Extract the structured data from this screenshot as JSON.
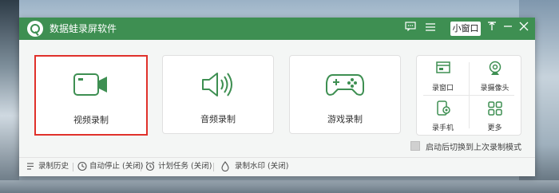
{
  "app": {
    "title": "数据蛙录屏软件",
    "accent": "#3e8f52",
    "mini_window_label": "小窗口"
  },
  "titlebar_icons": [
    "message-icon",
    "menu-icon",
    "pin-icon",
    "minimize-icon",
    "close-icon"
  ],
  "cards": [
    {
      "label": "视频录制",
      "icon": "camera-icon",
      "selected": true
    },
    {
      "label": "音频录制",
      "icon": "speaker-icon",
      "selected": false
    },
    {
      "label": "游戏录制",
      "icon": "gamepad-icon",
      "selected": false
    }
  ],
  "mini_panel": [
    {
      "label": "录窗口",
      "icon": "window-icon"
    },
    {
      "label": "录摄像头",
      "icon": "webcam-icon"
    },
    {
      "label": "录手机",
      "icon": "phone-icon"
    },
    {
      "label": "更多",
      "icon": "grid-icon"
    }
  ],
  "option": {
    "label": "启动后切换到上次录制模式",
    "checked": false
  },
  "status": [
    {
      "label": "录制历史",
      "icon": "history-icon"
    },
    {
      "label": "自动停止 (关闭)",
      "icon": "clock-icon"
    },
    {
      "label": "计划任务 (关闭)",
      "icon": "alarm-icon"
    },
    {
      "label": "录制水印 (关闭)",
      "icon": "drop-icon"
    }
  ]
}
